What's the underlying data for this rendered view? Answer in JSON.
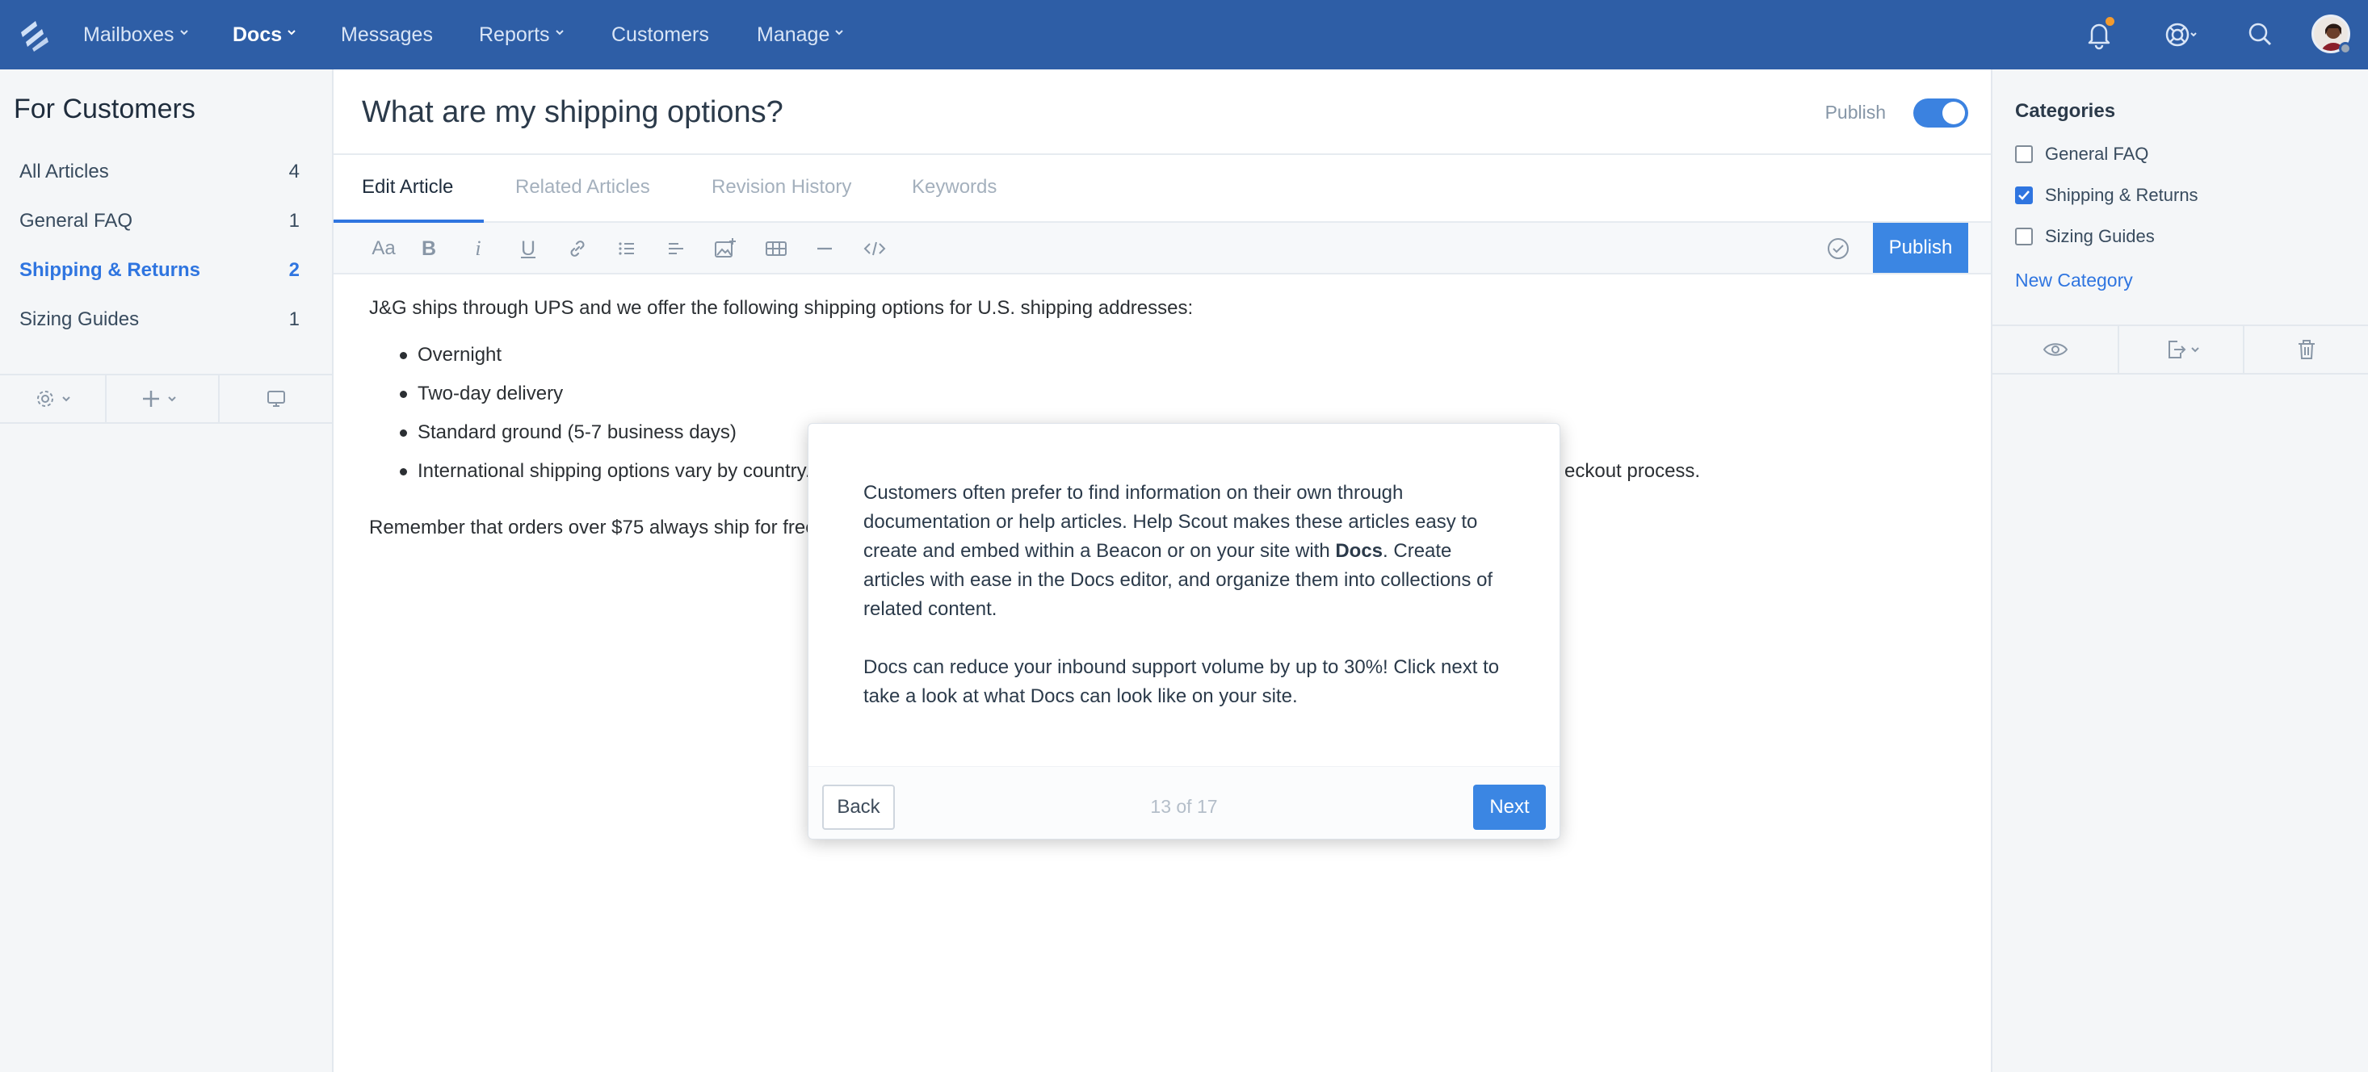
{
  "nav": {
    "items": [
      {
        "label": "Mailboxes",
        "has_menu": true,
        "active": false
      },
      {
        "label": "Docs",
        "has_menu": true,
        "active": true
      },
      {
        "label": "Messages",
        "has_menu": false,
        "active": false
      },
      {
        "label": "Reports",
        "has_menu": true,
        "active": false
      },
      {
        "label": "Customers",
        "has_menu": false,
        "active": false
      },
      {
        "label": "Manage",
        "has_menu": true,
        "active": false
      }
    ],
    "icons": [
      "logo-icon",
      "bell-icon",
      "help-icon",
      "search-icon",
      "avatar"
    ],
    "notification_dot_color": "#f39b2e",
    "background_color": "#2e5ea6"
  },
  "left_sidebar": {
    "collection_title": "For Customers",
    "categories": [
      {
        "label": "All Articles",
        "count": "4",
        "active": false
      },
      {
        "label": "General FAQ",
        "count": "1",
        "active": false
      },
      {
        "label": "Shipping & Returns",
        "count": "2",
        "active": true
      },
      {
        "label": "Sizing Guides",
        "count": "1",
        "active": false
      }
    ],
    "tools": [
      "gear-icon",
      "plus-icon",
      "preview-icon"
    ]
  },
  "editor": {
    "title": "What are my shipping options?",
    "publish_label": "Publish",
    "published": true,
    "tabs": [
      {
        "label": "Edit Article",
        "active": true
      },
      {
        "label": "Related Articles",
        "active": false
      },
      {
        "label": "Revision History",
        "active": false
      },
      {
        "label": "Keywords",
        "active": false
      }
    ],
    "toolbar": {
      "buttons": [
        "font-size-icon",
        "bold-icon",
        "italic-icon",
        "underline-icon",
        "link-icon",
        "bulleted-list-icon",
        "align-icon",
        "image-icon",
        "table-icon",
        "horizontal-rule-icon",
        "code-icon"
      ],
      "publish_button": "Publish"
    },
    "content": {
      "intro": "J&G ships through UPS and we offer the following shipping options for U.S. shipping addresses:",
      "list": [
        "Overnight",
        "Two-day delivery",
        "Standard ground (5-7 business days)",
        "International shipping options vary by country. Y"
      ],
      "list_tail": "eckout process.",
      "outro": "Remember that orders over $75 always ship for free"
    }
  },
  "right_sidebar": {
    "title": "Categories",
    "categories": [
      {
        "label": "General FAQ",
        "checked": false
      },
      {
        "label": "Shipping & Returns",
        "checked": true
      },
      {
        "label": "Sizing Guides",
        "checked": false
      }
    ],
    "new_category": "New Category",
    "tools": [
      "eye-icon",
      "move-icon",
      "trash-icon"
    ]
  },
  "tour": {
    "p1_a": "Customers often prefer to find information on their own through documentation or help articles. Help Scout makes these articles easy to create and embed within a Beacon or on your site with ",
    "p1_bold": "Docs",
    "p1_b": ". Create articles with ease in the Docs editor, and organize them into collections of related content.",
    "p2": "Docs can reduce your inbound support volume by up to 30%! Click next to take a look at what Docs can look like on your site.",
    "back": "Back",
    "progress": "13 of 17",
    "next": "Next"
  }
}
